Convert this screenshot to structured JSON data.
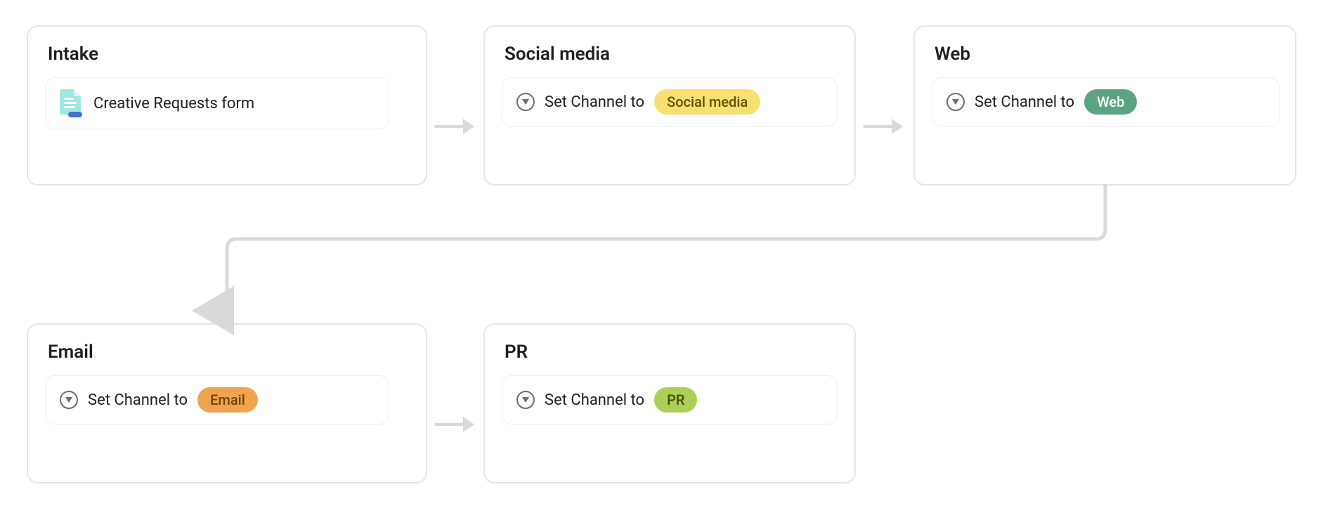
{
  "nodes": {
    "intake": {
      "title": "Intake",
      "form_label": "Creative Requests form"
    },
    "social": {
      "title": "Social media",
      "action_text": "Set Channel to",
      "pill_text": "Social media"
    },
    "web": {
      "title": "Web",
      "action_text": "Set Channel to",
      "pill_text": "Web"
    },
    "email": {
      "title": "Email",
      "action_text": "Set Channel to",
      "pill_text": "Email"
    },
    "pr": {
      "title": "PR",
      "action_text": "Set Channel to",
      "pill_text": "PR"
    }
  }
}
